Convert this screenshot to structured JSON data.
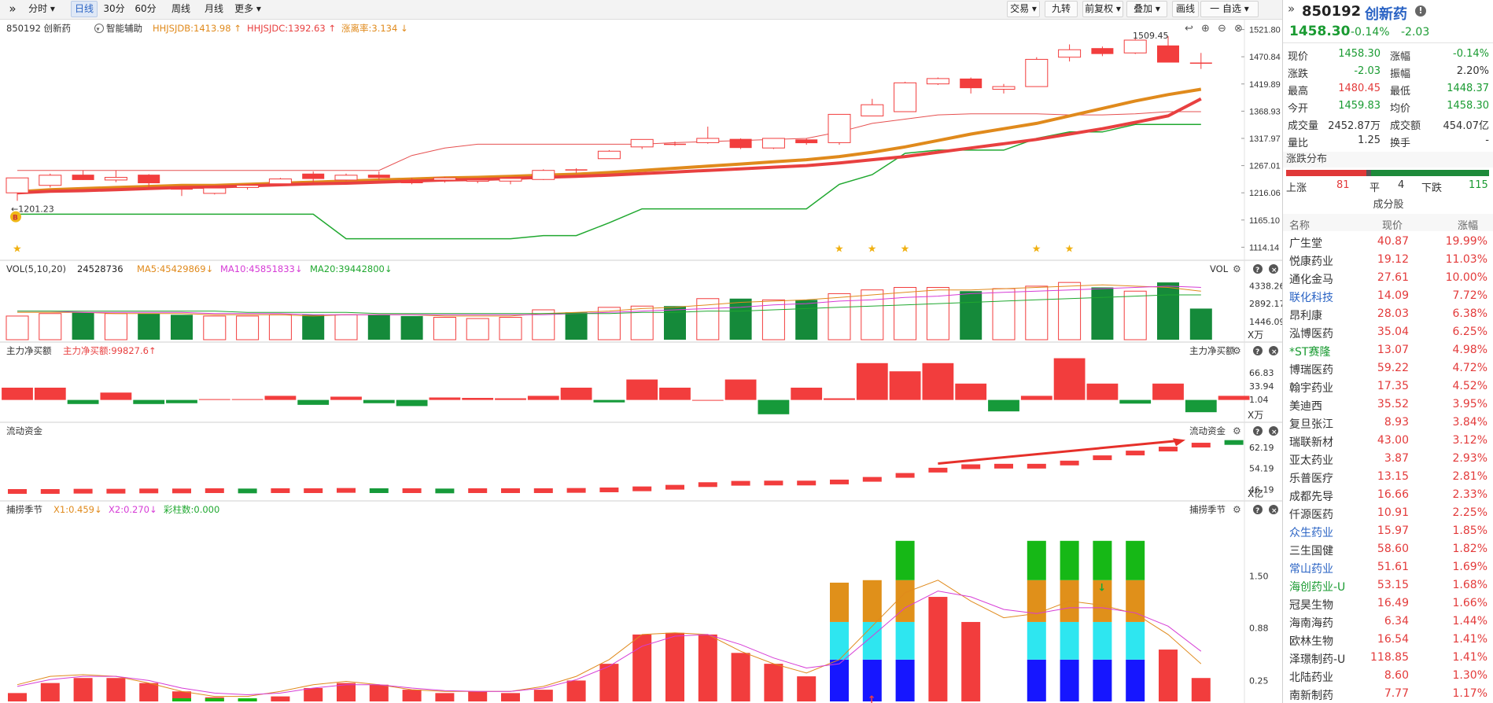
{
  "toolbar": {
    "collapse_glyph": "»",
    "left": [
      {
        "label": "分时",
        "arrow": "▾",
        "active": false
      },
      {
        "label": "日线",
        "arrow": "",
        "active": true
      },
      {
        "label": "30分",
        "arrow": "",
        "active": false
      },
      {
        "label": "60分",
        "arrow": "",
        "active": false
      },
      {
        "label": "周线",
        "arrow": "",
        "active": false
      },
      {
        "label": "月线",
        "arrow": "",
        "active": false
      },
      {
        "label": "更多",
        "arrow": "▾",
        "active": false
      }
    ],
    "right": [
      {
        "label": "交易",
        "arrow": "▾"
      },
      {
        "label": "九转",
        "arrow": ""
      },
      {
        "label": "前复权",
        "arrow": "▾"
      },
      {
        "label": "叠加",
        "arrow": "▾"
      },
      {
        "label": "画线",
        "arrow": ""
      },
      {
        "label": "一 自选",
        "arrow": "▾"
      }
    ]
  },
  "main_chart": {
    "code_label": "850192 创新药",
    "assist_label": "智能辅助",
    "ind1": "HHJSJDB:1413.98",
    "ind2": "HHJSJDC:1392.63",
    "ind3": "涨离率:3.134",
    "high_marker": "1509.45",
    "low_marker": "1201.23",
    "b_badge": "B",
    "y_labels": [
      "1521.80",
      "1470.84",
      "1419.89",
      "1368.93",
      "1317.97",
      "1267.01",
      "1216.06",
      "1165.10",
      "1114.14"
    ]
  },
  "vol_panel": {
    "title": "VOL(5,10,20)",
    "value": "24528736",
    "ma5": "MA5:45429869",
    "ma10": "MA10:45851833",
    "ma20": "MA20:39442800",
    "right_title": "VOL",
    "y_labels": [
      "4338.26",
      "2892.17",
      "1446.09"
    ],
    "unit": "X万"
  },
  "flow_panel": {
    "title": "主力净买额",
    "value": "主力净买额:99827.6",
    "right_title": "主力净买额",
    "y_labels": [
      "66.83",
      "33.94",
      "1.04"
    ],
    "unit": "X万"
  },
  "liquid_panel": {
    "title": "流动资金",
    "right_title": "流动资金",
    "y_labels": [
      "62.19",
      "54.19",
      "46.19"
    ],
    "unit": "X亿"
  },
  "season_panel": {
    "title": "捕捞季节",
    "x1": "X1:0.459",
    "x2": "X2:0.270",
    "bars": "彩柱数:0.000",
    "right_title": "捕捞季节",
    "y_labels": [
      "1.50",
      "0.88",
      "0.25"
    ]
  },
  "chart_data": {
    "type": "candlestick",
    "title": "850192 创新药",
    "ylim": [
      1100,
      1530
    ],
    "candles": [
      {
        "o": 1216,
        "h": 1244,
        "l": 1201,
        "c": 1244
      },
      {
        "o": 1230,
        "h": 1252,
        "l": 1226,
        "c": 1249
      },
      {
        "o": 1250,
        "h": 1258,
        "l": 1240,
        "c": 1240
      },
      {
        "o": 1240,
        "h": 1258,
        "l": 1236,
        "c": 1245
      },
      {
        "o": 1250,
        "h": 1251,
        "l": 1227,
        "c": 1234
      },
      {
        "o": 1225,
        "h": 1228,
        "l": 1210,
        "c": 1222
      },
      {
        "o": 1215,
        "h": 1228,
        "l": 1213,
        "c": 1225
      },
      {
        "o": 1226,
        "h": 1232,
        "l": 1222,
        "c": 1230
      },
      {
        "o": 1233,
        "h": 1244,
        "l": 1232,
        "c": 1242
      },
      {
        "o": 1252,
        "h": 1256,
        "l": 1236,
        "c": 1242
      },
      {
        "o": 1240,
        "h": 1252,
        "l": 1238,
        "c": 1249
      },
      {
        "o": 1250,
        "h": 1256,
        "l": 1240,
        "c": 1244
      },
      {
        "o": 1240,
        "h": 1244,
        "l": 1232,
        "c": 1234
      },
      {
        "o": 1240,
        "h": 1246,
        "l": 1235,
        "c": 1244
      },
      {
        "o": 1238,
        "h": 1244,
        "l": 1234,
        "c": 1240
      },
      {
        "o": 1238,
        "h": 1245,
        "l": 1232,
        "c": 1243
      },
      {
        "o": 1241,
        "h": 1260,
        "l": 1240,
        "c": 1258
      },
      {
        "o": 1260,
        "h": 1262,
        "l": 1253,
        "c": 1259
      },
      {
        "o": 1280,
        "h": 1296,
        "l": 1280,
        "c": 1294
      },
      {
        "o": 1302,
        "h": 1316,
        "l": 1298,
        "c": 1316
      },
      {
        "o": 1308,
        "h": 1312,
        "l": 1304,
        "c": 1306
      },
      {
        "o": 1310,
        "h": 1340,
        "l": 1308,
        "c": 1318
      },
      {
        "o": 1317,
        "h": 1318,
        "l": 1298,
        "c": 1300
      },
      {
        "o": 1300,
        "h": 1318,
        "l": 1298,
        "c": 1318
      },
      {
        "o": 1316,
        "h": 1318,
        "l": 1306,
        "c": 1309
      },
      {
        "o": 1310,
        "h": 1360,
        "l": 1306,
        "c": 1363
      },
      {
        "o": 1360,
        "h": 1392,
        "l": 1360,
        "c": 1381
      },
      {
        "o": 1368,
        "h": 1424,
        "l": 1368,
        "c": 1422
      },
      {
        "o": 1420,
        "h": 1432,
        "l": 1418,
        "c": 1430
      },
      {
        "o": 1430,
        "h": 1432,
        "l": 1402,
        "c": 1412
      },
      {
        "o": 1410,
        "h": 1420,
        "l": 1402,
        "c": 1415
      },
      {
        "o": 1415,
        "h": 1470,
        "l": 1415,
        "c": 1466
      },
      {
        "o": 1470,
        "h": 1494,
        "l": 1462,
        "c": 1484
      },
      {
        "o": 1487,
        "h": 1490,
        "l": 1472,
        "c": 1476
      },
      {
        "o": 1478,
        "h": 1505,
        "l": 1476,
        "c": 1502
      },
      {
        "o": 1492,
        "h": 1509,
        "l": 1460,
        "c": 1460
      },
      {
        "o": 1460,
        "h": 1478,
        "l": 1448,
        "c": 1458
      }
    ],
    "line_orange": [
      1218,
      1222,
      1224,
      1226,
      1228,
      1230,
      1230,
      1232,
      1234,
      1236,
      1238,
      1240,
      1242,
      1244,
      1245,
      1247,
      1249,
      1251,
      1254,
      1258,
      1262,
      1266,
      1270,
      1274,
      1278,
      1284,
      1292,
      1302,
      1314,
      1326,
      1336,
      1346,
      1360,
      1374,
      1388,
      1400,
      1410
    ],
    "line_red": [
      1216,
      1219,
      1220,
      1222,
      1224,
      1226,
      1227,
      1229,
      1231,
      1233,
      1234,
      1236,
      1238,
      1240,
      1241,
      1243,
      1245,
      1247,
      1249,
      1252,
      1255,
      1258,
      1261,
      1264,
      1267,
      1272,
      1278,
      1284,
      1292,
      1300,
      1308,
      1316,
      1326,
      1336,
      1348,
      1360,
      1392
    ],
    "line_red_thin": [
      1258,
      1258,
      1258,
      1258,
      1258,
      1258,
      1258,
      1258,
      1258,
      1258,
      1258,
      1258,
      1286,
      1300,
      1307,
      1307,
      1307,
      1307,
      1307,
      1307,
      1310,
      1312,
      1314,
      1316,
      1318,
      1330,
      1346,
      1354,
      1362,
      1364,
      1364,
      1364,
      1362,
      1362,
      1364,
      1368,
      1368
    ],
    "line_green": [
      1176,
      1176,
      1176,
      1176,
      1176,
      1176,
      1176,
      1176,
      1176,
      1176,
      1130,
      1130,
      1130,
      1130,
      1130,
      1130,
      1136,
      1136,
      1160,
      1186,
      1186,
      1186,
      1186,
      1186,
      1186,
      1232,
      1250,
      1290,
      1296,
      1296,
      1296,
      1318,
      1330,
      1330,
      1344,
      1344,
      1344
    ],
    "volume": [
      1.9,
      2.1,
      2.2,
      2.1,
      2.1,
      2.0,
      1.9,
      1.9,
      2.0,
      2.0,
      2.0,
      2.0,
      1.9,
      1.8,
      1.7,
      1.8,
      2.4,
      2.2,
      2.6,
      2.7,
      2.7,
      3.3,
      3.3,
      3.2,
      3.2,
      3.7,
      4.0,
      4.2,
      4.2,
      3.9,
      4.1,
      4.3,
      4.6,
      4.2,
      3.9,
      4.6,
      2.5
    ],
    "vol_ma5": [
      2.2,
      2.2,
      2.2,
      2.1,
      2.1,
      2.1,
      2.0,
      2.0,
      2.0,
      1.9,
      2.0,
      2.0,
      2.0,
      1.9,
      1.9,
      1.9,
      2.1,
      2.2,
      2.3,
      2.5,
      2.6,
      2.8,
      3.0,
      3.1,
      3.2,
      3.4,
      3.6,
      3.8,
      4.0,
      4.0,
      4.1,
      4.2,
      4.3,
      4.4,
      4.3,
      4.2,
      3.9
    ],
    "vol_ma10": [
      2.3,
      2.3,
      2.2,
      2.2,
      2.2,
      2.2,
      2.1,
      2.1,
      2.1,
      2.0,
      2.0,
      2.0,
      2.0,
      2.0,
      2.0,
      2.0,
      2.0,
      2.1,
      2.2,
      2.3,
      2.4,
      2.5,
      2.6,
      2.8,
      2.9,
      3.1,
      3.2,
      3.4,
      3.5,
      3.7,
      3.8,
      3.9,
      4.0,
      4.1,
      4.2,
      4.3,
      4.2
    ],
    "vol_ma20": [
      2.3,
      2.3,
      2.3,
      2.3,
      2.3,
      2.3,
      2.3,
      2.2,
      2.2,
      2.2,
      2.2,
      2.1,
      2.1,
      2.1,
      2.1,
      2.1,
      2.1,
      2.1,
      2.1,
      2.2,
      2.2,
      2.3,
      2.3,
      2.4,
      2.5,
      2.6,
      2.7,
      2.8,
      2.9,
      3.0,
      3.1,
      3.2,
      3.3,
      3.4,
      3.5,
      3.6,
      3.6
    ],
    "net_flow": [
      30,
      30,
      -10,
      18,
      -10,
      -8,
      2,
      2,
      10,
      -12,
      8,
      -8,
      -15,
      6,
      5,
      4,
      10,
      30,
      -6,
      50,
      30,
      0,
      50,
      -35,
      30,
      4,
      90,
      70,
      90,
      40,
      -28,
      10,
      102,
      40,
      -9,
      40,
      -30,
      10
    ],
    "liquid": [
      45.4,
      45.4,
      45.5,
      45.5,
      45.6,
      45.6,
      45.7,
      45.6,
      45.7,
      45.7,
      45.8,
      45.7,
      45.7,
      45.6,
      45.7,
      45.7,
      45.7,
      45.8,
      46.0,
      46.4,
      47.0,
      48.0,
      48.5,
      48.6,
      48.6,
      49.0,
      50.0,
      51.5,
      53.5,
      54.8,
      55.0,
      55.0,
      56.2,
      58.2,
      60.0,
      61.5,
      63.0,
      64.0
    ]
  },
  "right_panel": {
    "code": "850192",
    "name": "创新药",
    "price": "1458.30",
    "change_pct": "-0.14%",
    "change": "-2.03",
    "quotes": [
      {
        "k1": "现价",
        "v1": "1458.30",
        "c1": "green",
        "k2": "涨幅",
        "v2": "-0.14%",
        "c2": "green"
      },
      {
        "k1": "涨跌",
        "v1": "-2.03",
        "c1": "green",
        "k2": "振幅",
        "v2": "2.20%",
        "c2": "gray"
      },
      {
        "k1": "最高",
        "v1": "1480.45",
        "c1": "red",
        "k2": "最低",
        "v2": "1448.37",
        "c2": "green"
      },
      {
        "k1": "今开",
        "v1": "1459.83",
        "c1": "green",
        "k2": "均价",
        "v2": "1458.30",
        "c2": "green"
      },
      {
        "k1": "成交量",
        "v1": "2452.87万",
        "c1": "gray",
        "k2": "成交额",
        "v2": "454.07亿",
        "c2": "gray"
      },
      {
        "k1": "量比",
        "v1": "1.25",
        "c1": "gray",
        "k2": "换手",
        "v2": "-",
        "c2": "gray"
      }
    ],
    "dist_title": "涨跌分布",
    "dist": {
      "up_label": "上涨",
      "up": "81",
      "flat_label": "平",
      "flat": "4",
      "down_label": "下跌",
      "down": "115"
    },
    "components_title": "成分股",
    "col_name": "名称",
    "col_price": "现价",
    "col_pct": "涨幅",
    "stocks": [
      {
        "name": "广生堂",
        "price": "40.87",
        "pct": "19.99%",
        "nc": "gray"
      },
      {
        "name": "悦康药业",
        "price": "19.12",
        "pct": "11.03%",
        "nc": "gray"
      },
      {
        "name": "通化金马",
        "price": "27.61",
        "pct": "10.00%",
        "nc": "gray"
      },
      {
        "name": "联化科技",
        "price": "14.09",
        "pct": "7.72%",
        "nc": "blue"
      },
      {
        "name": "昂利康",
        "price": "28.03",
        "pct": "6.38%",
        "nc": "gray"
      },
      {
        "name": "泓博医药",
        "price": "35.04",
        "pct": "6.25%",
        "nc": "gray"
      },
      {
        "name": "*ST赛隆",
        "price": "13.07",
        "pct": "4.98%",
        "nc": "green"
      },
      {
        "name": "博瑞医药",
        "price": "59.22",
        "pct": "4.72%",
        "nc": "gray"
      },
      {
        "name": "翰宇药业",
        "price": "17.35",
        "pct": "4.52%",
        "nc": "gray"
      },
      {
        "name": "美迪西",
        "price": "35.52",
        "pct": "3.95%",
        "nc": "gray"
      },
      {
        "name": "复旦张江",
        "price": "8.93",
        "pct": "3.84%",
        "nc": "gray"
      },
      {
        "name": "瑞联新材",
        "price": "43.00",
        "pct": "3.12%",
        "nc": "gray"
      },
      {
        "name": "亚太药业",
        "price": "3.87",
        "pct": "2.93%",
        "nc": "gray"
      },
      {
        "name": "乐普医疗",
        "price": "13.15",
        "pct": "2.81%",
        "nc": "gray"
      },
      {
        "name": "成都先导",
        "price": "16.66",
        "pct": "2.33%",
        "nc": "gray"
      },
      {
        "name": "仟源医药",
        "price": "10.91",
        "pct": "2.25%",
        "nc": "gray"
      },
      {
        "name": "众生药业",
        "price": "15.97",
        "pct": "1.85%",
        "nc": "blue"
      },
      {
        "name": "三生国健",
        "price": "58.60",
        "pct": "1.82%",
        "nc": "gray"
      },
      {
        "name": "常山药业",
        "price": "51.61",
        "pct": "1.69%",
        "nc": "blue"
      },
      {
        "name": "海创药业-U",
        "price": "53.15",
        "pct": "1.68%",
        "nc": "green"
      },
      {
        "name": "冠昊生物",
        "price": "16.49",
        "pct": "1.66%",
        "nc": "gray"
      },
      {
        "name": "海南海药",
        "price": "6.34",
        "pct": "1.44%",
        "nc": "gray"
      },
      {
        "name": "欧林生物",
        "price": "16.54",
        "pct": "1.41%",
        "nc": "gray"
      },
      {
        "name": "泽璟制药-U",
        "price": "118.85",
        "pct": "1.41%",
        "nc": "gray"
      },
      {
        "name": "北陆药业",
        "price": "8.60",
        "pct": "1.30%",
        "nc": "gray"
      },
      {
        "name": "南新制药",
        "price": "7.77",
        "pct": "1.17%",
        "nc": "gray"
      }
    ]
  },
  "colors": {
    "up": "#f23d3d",
    "down": "#158a3a",
    "orange": "#e08a1c",
    "red_line": "#e84040",
    "green_line": "#20a830",
    "magenta": "#d63cd6",
    "cyan": "#2ee6f0",
    "blue_bar": "#1616ff",
    "green_bar": "#16b816"
  }
}
